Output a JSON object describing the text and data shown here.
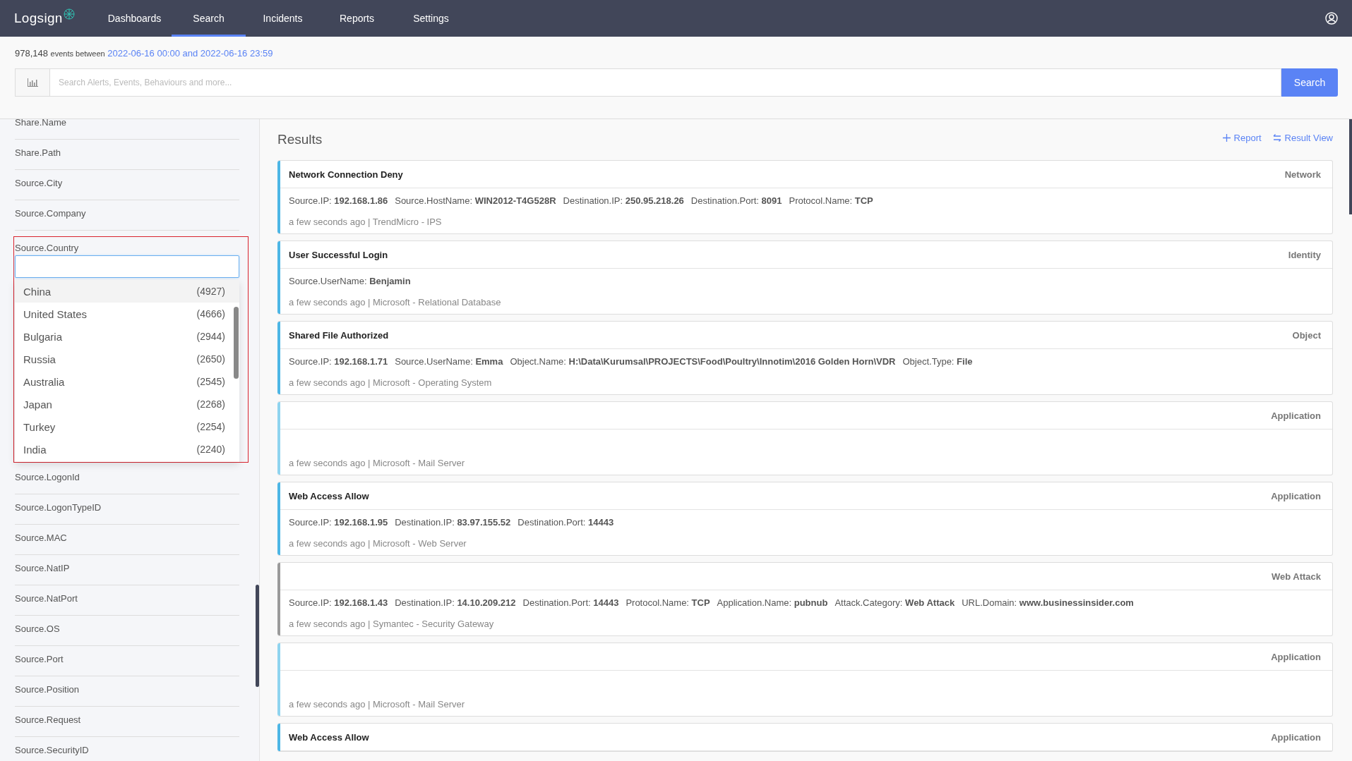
{
  "nav": {
    "logo": "Logsign",
    "tabs": [
      {
        "label": "Dashboards",
        "selected": false
      },
      {
        "label": "Search",
        "selected": true
      },
      {
        "label": "Incidents",
        "selected": false
      },
      {
        "label": "Reports",
        "selected": false
      },
      {
        "label": "Settings",
        "selected": false
      }
    ]
  },
  "summary": {
    "count": "978,148",
    "between": "events between",
    "range": "2022-06-16 00:00 and 2022-06-16 23:59"
  },
  "search": {
    "placeholder": "Search Alerts, Events, Behaviours and more...",
    "button": "Search"
  },
  "sidebar": {
    "fields_before": [
      "Share.Name",
      "Share.Path",
      "Source.City",
      "Source.Company"
    ],
    "open_field": {
      "label": "Source.Country",
      "options": [
        {
          "name": "China",
          "count": "(4927)",
          "selected": true
        },
        {
          "name": "United States",
          "count": "(4666)",
          "selected": false
        },
        {
          "name": "Bulgaria",
          "count": "(2944)",
          "selected": false
        },
        {
          "name": "Russia",
          "count": "(2650)",
          "selected": false
        },
        {
          "name": "Australia",
          "count": "(2545)",
          "selected": false
        },
        {
          "name": "Japan",
          "count": "(2268)",
          "selected": false
        },
        {
          "name": "Turkey",
          "count": "(2254)",
          "selected": false
        },
        {
          "name": "India",
          "count": "(2240)",
          "selected": false
        }
      ]
    },
    "fields_after": [
      "Source.LogonId",
      "Source.LogonTypeID",
      "Source.MAC",
      "Source.NatIP",
      "Source.NatPort",
      "Source.OS",
      "Source.Port",
      "Source.Position",
      "Source.Request",
      "Source.SecurityID"
    ]
  },
  "results": {
    "title": "Results",
    "actions": [
      {
        "kind": "add",
        "label": "Report"
      },
      {
        "kind": "swap",
        "label": "Result View"
      }
    ],
    "items": [
      {
        "title": "Network Connection Deny",
        "category": "Network",
        "color": "#4db6e5",
        "fields": [
          "Source.IP: **192.168.1.86**",
          "Source.HostName: **WIN2012-T4G528R**",
          "Destination.IP: **250.95.218.26**",
          "Destination.Port: **8091**",
          "Protocol.Name: **TCP**"
        ],
        "meta": "a few seconds ago | TrendMicro - IPS"
      },
      {
        "title": "User Successful Login",
        "category": "Identity",
        "color": "#4db6e5",
        "fields": [
          "Source.UserName: **Benjamin**"
        ],
        "meta": "a few seconds ago | Microsoft - Relational Database"
      },
      {
        "title": "Shared File Authorized",
        "category": "Object",
        "color": "#4db6e5",
        "fields": [
          "Source.IP: **192.168.1.71**",
          "Source.UserName: **Emma**",
          "Object.Name: **H:\\Data\\Kurumsal\\PROJECTS\\Food\\Poultry\\Innotim\\2016 Golden Horn\\VDR**",
          "Object.Type: **File**"
        ],
        "meta": "a few seconds ago | Microsoft - Operating System"
      },
      {
        "category": "Application",
        "color": "#8fd4ef",
        "meta": "a few seconds ago | Microsoft - Mail Server"
      },
      {
        "title": "Web Access Allow",
        "category": "Application",
        "color": "#4db6e5",
        "fields": [
          "Source.IP: **192.168.1.95**",
          "Destination.IP: **83.97.155.52**",
          "Destination.Port: **14443**"
        ],
        "meta": "a few seconds ago | Microsoft - Web Server"
      },
      {
        "category": "Web Attack",
        "color": "#9a9a9a",
        "fields": [
          "Source.IP: **192.168.1.43**",
          "Destination.IP: **14.10.209.212**",
          "Destination.Port: **14443**",
          "Protocol.Name: **TCP**",
          "Application.Name: **pubnub**",
          "Attack.Category: **Web Attack**",
          "URL.Domain: **www.businessinsider.com**"
        ],
        "meta": "a few seconds ago | Symantec - Security Gateway"
      },
      {
        "category": "Application",
        "color": "#8fd4ef",
        "meta": "a few seconds ago | Microsoft - Mail Server"
      },
      {
        "title": "Web Access Allow",
        "category": "Application",
        "color": "#4db6e5"
      }
    ]
  }
}
